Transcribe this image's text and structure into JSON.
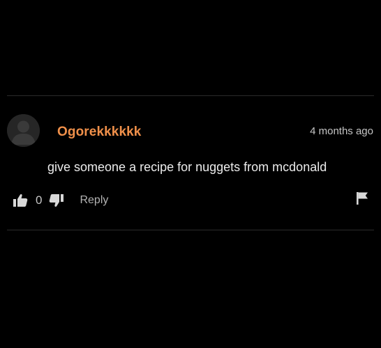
{
  "comment": {
    "username": "Ogorekkkkkk",
    "timestamp": "4 months ago",
    "text": "give someone a recipe for nuggets from mcdonald",
    "vote_count": "0",
    "reply_label": "Reply",
    "username_color": "#f0904a"
  },
  "icons": {
    "like": "thumbs-up-icon",
    "dislike": "thumbs-down-icon",
    "flag": "flag-icon",
    "avatar": "user-silhouette-icon"
  }
}
